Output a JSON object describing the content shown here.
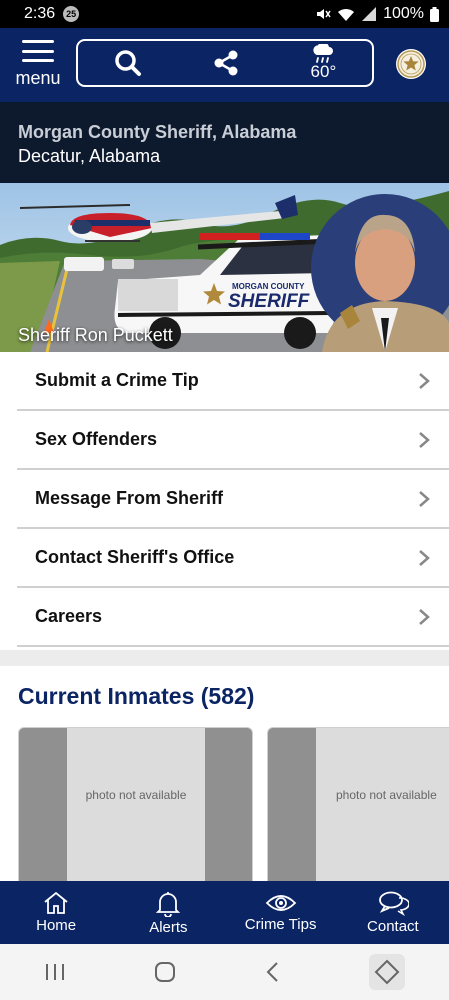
{
  "status_bar": {
    "time": "2:36",
    "notification_count": "25",
    "battery": "100%"
  },
  "header": {
    "menu_label": "menu",
    "weather_temp": "60°"
  },
  "agency": {
    "name": "Morgan County Sheriff, Alabama",
    "city": "Decatur, Alabama"
  },
  "hero": {
    "caption": "Sheriff Ron Puckett",
    "vehicle_text": "SHERIFF",
    "vehicle_subtext": "MORGAN COUNTY"
  },
  "menu_items": [
    {
      "label": "Submit a Crime Tip"
    },
    {
      "label": "Sex Offenders"
    },
    {
      "label": "Message From Sheriff"
    },
    {
      "label": "Contact Sheriff's Office"
    },
    {
      "label": "Careers"
    }
  ],
  "inmates": {
    "title": "Current Inmates (582)",
    "cards": [
      {
        "photo_text": "photo not available"
      },
      {
        "photo_text": "photo not available"
      }
    ]
  },
  "bottom_nav": [
    {
      "label": "Home",
      "icon": "home-icon"
    },
    {
      "label": "Alerts",
      "icon": "bell-icon"
    },
    {
      "label": "Crime Tips",
      "icon": "eye-icon"
    },
    {
      "label": "Contact",
      "icon": "chat-icon"
    }
  ],
  "colors": {
    "primary": "#0b2463",
    "agency_bg": "#0d1a2e",
    "title": "#0b2463"
  }
}
